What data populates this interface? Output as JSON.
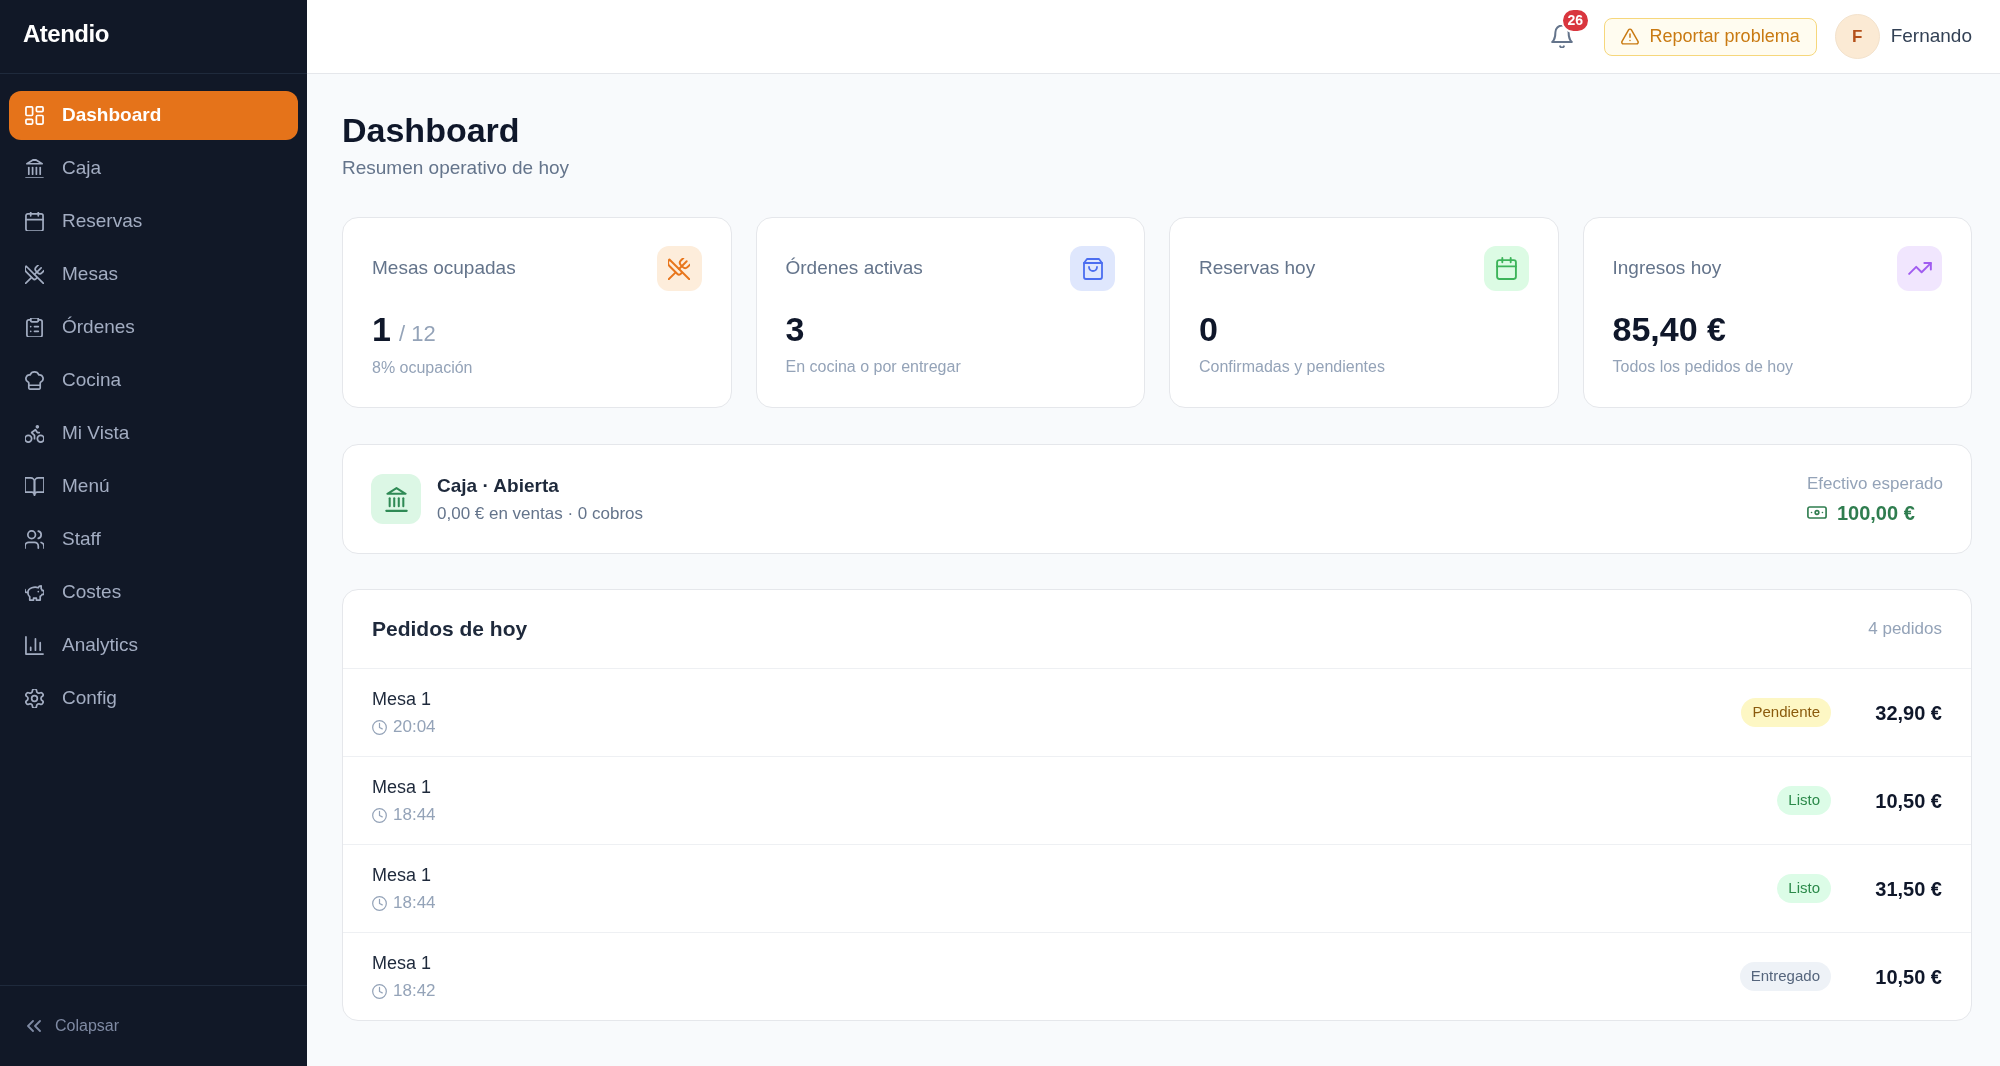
{
  "sidebar": {
    "logo": "Atendio",
    "items": [
      {
        "label": "Dashboard",
        "selected": true
      },
      {
        "label": "Caja",
        "selected": false
      },
      {
        "label": "Reservas",
        "selected": false
      },
      {
        "label": "Mesas",
        "selected": false
      },
      {
        "label": "Órdenes",
        "selected": false
      },
      {
        "label": "Cocina",
        "selected": false
      },
      {
        "label": "Mi Vista",
        "selected": false
      },
      {
        "label": "Menú",
        "selected": false
      },
      {
        "label": "Staff",
        "selected": false
      },
      {
        "label": "Costes",
        "selected": false
      },
      {
        "label": "Analytics",
        "selected": false
      },
      {
        "label": "Config",
        "selected": false
      }
    ],
    "collapse": "Colapsar"
  },
  "header": {
    "notifications": "26",
    "report_button": "Reportar problema",
    "user": {
      "initial": "F",
      "name": "Fernando"
    }
  },
  "page": {
    "title": "Dashboard",
    "subtitle": "Resumen operativo de hoy"
  },
  "stats": [
    {
      "label": "Mesas ocupadas",
      "value": "1",
      "suffix": "/ 12",
      "note": "8% ocupación"
    },
    {
      "label": "Órdenes activas",
      "value": "3",
      "note": "En cocina o por entregar"
    },
    {
      "label": "Reservas hoy",
      "value": "0",
      "note": "Confirmadas y pendientes"
    },
    {
      "label": "Ingresos hoy",
      "value": "85,40 €",
      "note": "Todos los pedidos de hoy"
    }
  ],
  "cash_register": {
    "title": "Caja · Abierta",
    "summary": "0,00 € en ventas · 0 cobros",
    "expected_label": "Efectivo esperado",
    "expected_amount": "100,00 €"
  },
  "orders": {
    "title": "Pedidos de hoy",
    "count": "4 pedidos",
    "rows": [
      {
        "table": "Mesa 1",
        "time": "20:04",
        "status": {
          "label": "Pendiente",
          "kind": "pending"
        },
        "total": "32,90 €"
      },
      {
        "table": "Mesa 1",
        "time": "18:44",
        "status": {
          "label": "Listo",
          "kind": "ready"
        },
        "total": "10,50 €"
      },
      {
        "table": "Mesa 1",
        "time": "18:44",
        "status": {
          "label": "Listo",
          "kind": "ready"
        },
        "total": "31,50 €"
      },
      {
        "table": "Mesa 1",
        "time": "18:42",
        "status": {
          "label": "Entregado",
          "kind": "delivered"
        },
        "total": "10,50 €"
      }
    ]
  }
}
